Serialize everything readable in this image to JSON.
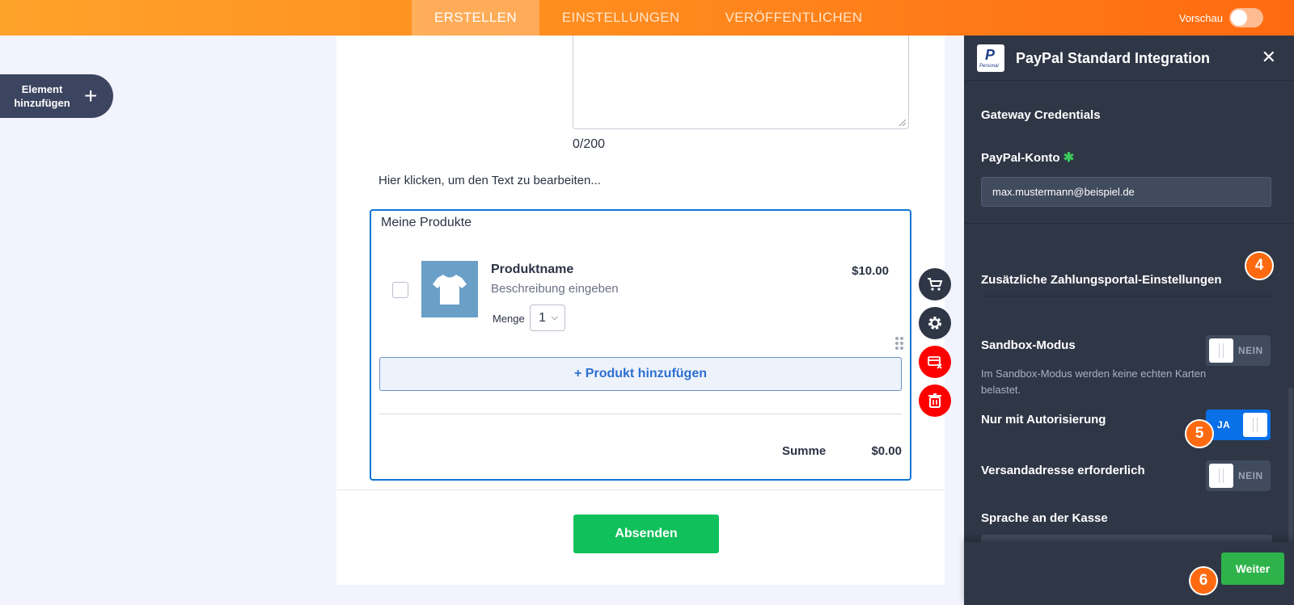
{
  "topbar": {
    "tabs": [
      {
        "label": "ERSTELLEN",
        "active": true
      },
      {
        "label": "EINSTELLUNGEN",
        "active": false
      },
      {
        "label": "VERÖFFENTLICHEN",
        "active": false
      }
    ],
    "preview_label": "Vorschau",
    "preview_on": false
  },
  "sidebar": {
    "add_element_label": "Element hinzufügen",
    "add_element_icon": "plus-icon"
  },
  "form": {
    "char_count": "0/200",
    "edit_text": "Hier klicken, um den Text zu bearbeiten...",
    "products": {
      "title": "Meine Produkte",
      "items": [
        {
          "name": "Produktname",
          "description": "Beschreibung eingeben",
          "price": "$10.00",
          "quantity_label": "Menge",
          "quantity": "1",
          "image_icon": "tshirt-icon"
        }
      ],
      "add_product_label": "+ Produkt hinzufügen",
      "sum_label": "Summe",
      "sum_value": "$0.00"
    },
    "submit_label": "Absenden"
  },
  "tools": [
    {
      "name": "cart-icon"
    },
    {
      "name": "gear-icon"
    },
    {
      "name": "remove-payment-icon"
    },
    {
      "name": "trash-icon"
    }
  ],
  "panel": {
    "logo_letter": "P",
    "logo_caption": "Personal",
    "title": "PayPal Standard Integration",
    "gateway_title": "Gateway Credentials",
    "account_label": "PayPal-Konto",
    "required_mark": "✱",
    "account_value": "max.mustermann@beispiel.de",
    "additional_title": "Zusätzliche Zahlungsportal-Einstellungen",
    "options": [
      {
        "label": "Sandbox-Modus",
        "state_text": "NEIN",
        "on": false,
        "description": "Im Sandbox-Modus werden keine echten Karten belastet."
      },
      {
        "label": "Nur mit Autorisierung",
        "state_text": "JA",
        "on": true
      },
      {
        "label": "Versandadresse erforderlich",
        "state_text": "NEIN",
        "on": false
      }
    ],
    "language_label": "Sprache an der Kasse",
    "next_label": "Weiter"
  },
  "badges": [
    "4",
    "5",
    "6"
  ],
  "colors": {
    "accent_orange": "#ff6a10",
    "panel_bg": "#2f3646",
    "submit_green": "#10c05b",
    "next_green": "#2db34a",
    "toggle_on_blue": "#0a70e8",
    "tool_red": "#ff0000"
  }
}
